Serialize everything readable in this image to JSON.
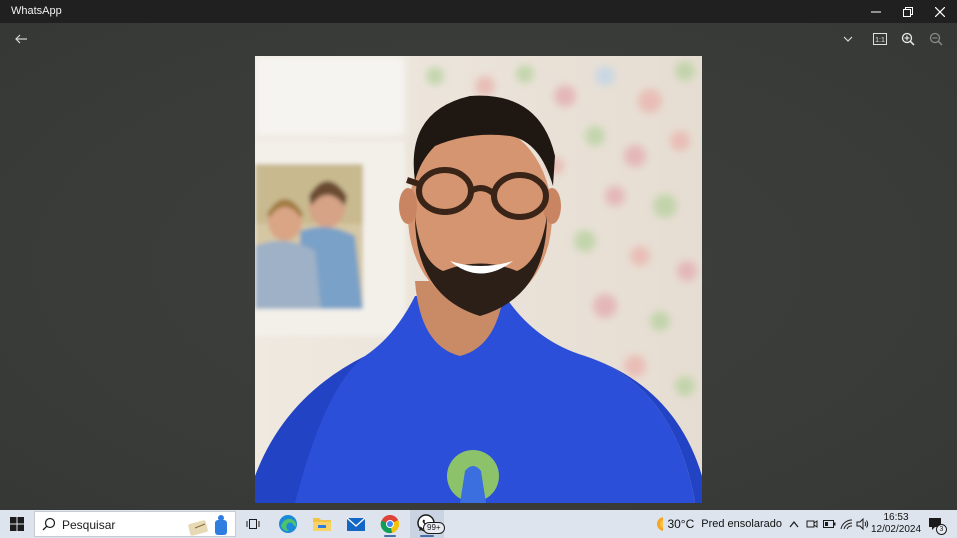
{
  "window": {
    "title": "WhatsApp",
    "controls": [
      "minimize-icon",
      "restore-icon",
      "close-icon"
    ]
  },
  "viewer": {
    "toolbar": [
      "back-arrow-icon",
      "chevron-down-icon",
      "actual-size-icon",
      "zoom-in-icon",
      "zoom-out-icon"
    ],
    "actual_size_label": "1:1"
  },
  "taskbar": {
    "search_placeholder": "Pesquisar",
    "pinned": [
      "task-view-icon",
      "edge-icon",
      "file-explorer-icon",
      "mail-icon",
      "chrome-icon",
      "whatsapp-icon"
    ],
    "whatsapp_badge": "99+",
    "weather_temp": "30°C",
    "weather_desc": "Pred ensolarado",
    "time": "16:53",
    "date": "12/02/2024",
    "notification_count": "3",
    "colors": {
      "taskbar_bg": "#dde4ee",
      "accent": "#0078d4",
      "whatsapp_green": "#25d366"
    }
  }
}
